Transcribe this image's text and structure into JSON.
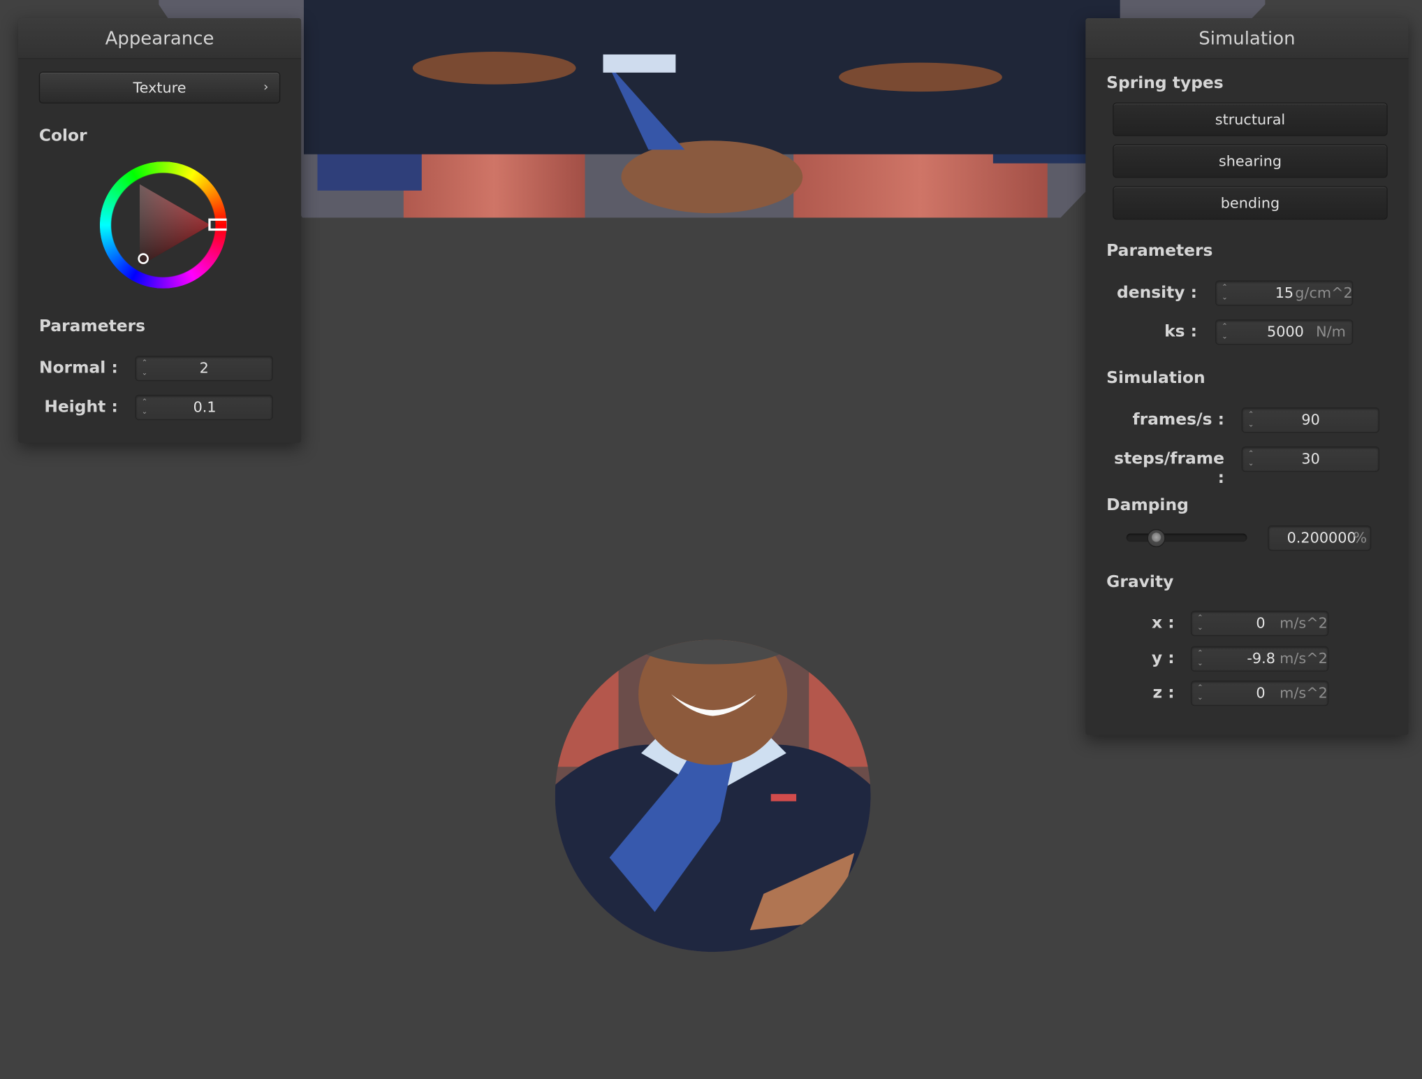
{
  "appearance": {
    "title": "Appearance",
    "texture_button": "Texture",
    "texture_chevron": "›",
    "color_label": "Color",
    "parameters_label": "Parameters",
    "normal_label": "Normal :",
    "normal_value": "2",
    "height_label": "Height :",
    "height_value": "0.1"
  },
  "simulation_panel": {
    "title": "Simulation",
    "spring_types_label": "Spring types",
    "spring_types": [
      "structural",
      "shearing",
      "bending"
    ],
    "parameters_label": "Parameters",
    "density_label": "density :",
    "density_value": "15",
    "density_unit": "g/cm^2",
    "ks_label": "ks :",
    "ks_value": "5000",
    "ks_unit": "N/m",
    "simulation_label": "Simulation",
    "fps_label": "frames/s :",
    "fps_value": "90",
    "steps_label": "steps/frame :",
    "steps_value": "30",
    "damping_label": "Damping",
    "damping_value": "0.200000",
    "damping_unit": "%",
    "damping_fraction": 0.2,
    "gravity_label": "Gravity",
    "gx_label": "x :",
    "gx_value": "0",
    "gy_label": "y :",
    "gy_value": "-9.8",
    "gz_label": "z :",
    "gz_value": "0",
    "gravity_unit": "m/s^2"
  },
  "spinner": {
    "up": "⌃",
    "down": "⌄"
  },
  "colors": {
    "background": "#414141",
    "panel": "#2e2e2e",
    "selected_color": "#e8242a"
  },
  "icons": [
    "chevron-right-icon",
    "spinner-arrows-icon",
    "color-wheel-icon",
    "slider-knob-icon"
  ]
}
